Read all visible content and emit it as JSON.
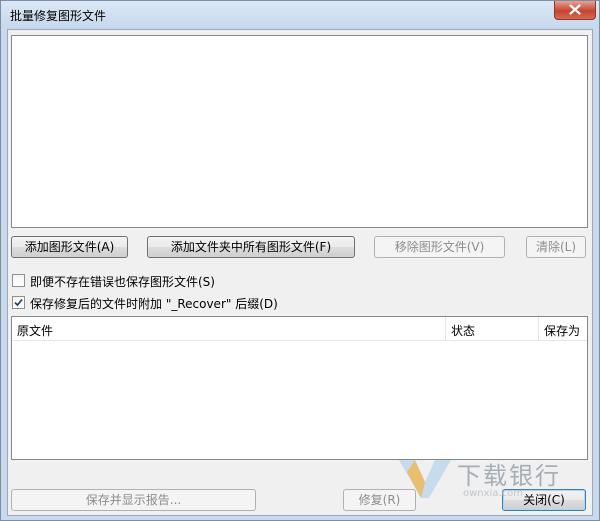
{
  "window": {
    "title": "批量修复图形文件"
  },
  "buttons": {
    "add_files": "添加图形文件(A)",
    "add_folder": "添加文件夹中所有图形文件(F)",
    "remove_files": "移除图形文件(V)",
    "clear": "清除(L)",
    "save_report": "保存并显示报告...",
    "repair": "修复(R)",
    "close": "关闭(C)"
  },
  "options": [
    {
      "label": "即便不存在错误也保存图形文件(S)",
      "checked": false
    },
    {
      "label": "保存修复后的文件时附加 \"_Recover\" 后缀(D)",
      "checked": true
    }
  ],
  "table": {
    "columns": [
      "原文件",
      "状态",
      "保存为"
    ],
    "rows": []
  },
  "watermark": {
    "text": "下载银行",
    "subtext": "ownxia.com"
  },
  "icons": {
    "close": "close-icon",
    "checkmark": "checkmark-icon",
    "watermark_logo": "v-logo-icon"
  }
}
